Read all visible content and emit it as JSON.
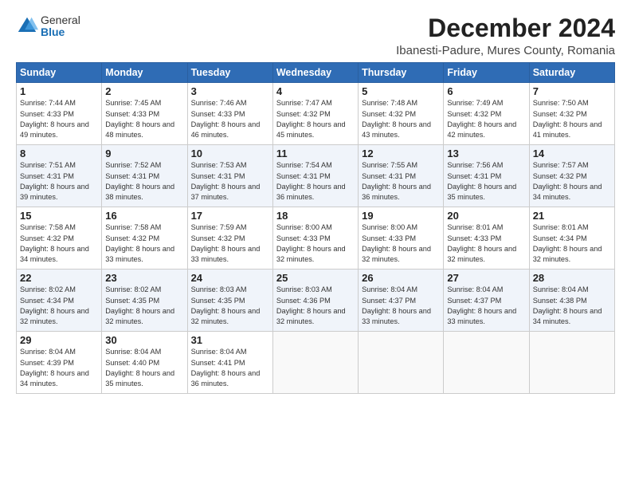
{
  "logo": {
    "general": "General",
    "blue": "Blue"
  },
  "title": "December 2024",
  "subtitle": "Ibanesti-Padure, Mures County, Romania",
  "weekdays": [
    "Sunday",
    "Monday",
    "Tuesday",
    "Wednesday",
    "Thursday",
    "Friday",
    "Saturday"
  ],
  "weeks": [
    [
      {
        "day": "1",
        "sunrise": "7:44 AM",
        "sunset": "4:33 PM",
        "daylight": "8 hours and 49 minutes."
      },
      {
        "day": "2",
        "sunrise": "7:45 AM",
        "sunset": "4:33 PM",
        "daylight": "8 hours and 48 minutes."
      },
      {
        "day": "3",
        "sunrise": "7:46 AM",
        "sunset": "4:33 PM",
        "daylight": "8 hours and 46 minutes."
      },
      {
        "day": "4",
        "sunrise": "7:47 AM",
        "sunset": "4:32 PM",
        "daylight": "8 hours and 45 minutes."
      },
      {
        "day": "5",
        "sunrise": "7:48 AM",
        "sunset": "4:32 PM",
        "daylight": "8 hours and 43 minutes."
      },
      {
        "day": "6",
        "sunrise": "7:49 AM",
        "sunset": "4:32 PM",
        "daylight": "8 hours and 42 minutes."
      },
      {
        "day": "7",
        "sunrise": "7:50 AM",
        "sunset": "4:32 PM",
        "daylight": "8 hours and 41 minutes."
      }
    ],
    [
      {
        "day": "8",
        "sunrise": "7:51 AM",
        "sunset": "4:31 PM",
        "daylight": "8 hours and 39 minutes."
      },
      {
        "day": "9",
        "sunrise": "7:52 AM",
        "sunset": "4:31 PM",
        "daylight": "8 hours and 38 minutes."
      },
      {
        "day": "10",
        "sunrise": "7:53 AM",
        "sunset": "4:31 PM",
        "daylight": "8 hours and 37 minutes."
      },
      {
        "day": "11",
        "sunrise": "7:54 AM",
        "sunset": "4:31 PM",
        "daylight": "8 hours and 36 minutes."
      },
      {
        "day": "12",
        "sunrise": "7:55 AM",
        "sunset": "4:31 PM",
        "daylight": "8 hours and 36 minutes."
      },
      {
        "day": "13",
        "sunrise": "7:56 AM",
        "sunset": "4:31 PM",
        "daylight": "8 hours and 35 minutes."
      },
      {
        "day": "14",
        "sunrise": "7:57 AM",
        "sunset": "4:32 PM",
        "daylight": "8 hours and 34 minutes."
      }
    ],
    [
      {
        "day": "15",
        "sunrise": "7:58 AM",
        "sunset": "4:32 PM",
        "daylight": "8 hours and 34 minutes."
      },
      {
        "day": "16",
        "sunrise": "7:58 AM",
        "sunset": "4:32 PM",
        "daylight": "8 hours and 33 minutes."
      },
      {
        "day": "17",
        "sunrise": "7:59 AM",
        "sunset": "4:32 PM",
        "daylight": "8 hours and 33 minutes."
      },
      {
        "day": "18",
        "sunrise": "8:00 AM",
        "sunset": "4:33 PM",
        "daylight": "8 hours and 32 minutes."
      },
      {
        "day": "19",
        "sunrise": "8:00 AM",
        "sunset": "4:33 PM",
        "daylight": "8 hours and 32 minutes."
      },
      {
        "day": "20",
        "sunrise": "8:01 AM",
        "sunset": "4:33 PM",
        "daylight": "8 hours and 32 minutes."
      },
      {
        "day": "21",
        "sunrise": "8:01 AM",
        "sunset": "4:34 PM",
        "daylight": "8 hours and 32 minutes."
      }
    ],
    [
      {
        "day": "22",
        "sunrise": "8:02 AM",
        "sunset": "4:34 PM",
        "daylight": "8 hours and 32 minutes."
      },
      {
        "day": "23",
        "sunrise": "8:02 AM",
        "sunset": "4:35 PM",
        "daylight": "8 hours and 32 minutes."
      },
      {
        "day": "24",
        "sunrise": "8:03 AM",
        "sunset": "4:35 PM",
        "daylight": "8 hours and 32 minutes."
      },
      {
        "day": "25",
        "sunrise": "8:03 AM",
        "sunset": "4:36 PM",
        "daylight": "8 hours and 32 minutes."
      },
      {
        "day": "26",
        "sunrise": "8:04 AM",
        "sunset": "4:37 PM",
        "daylight": "8 hours and 33 minutes."
      },
      {
        "day": "27",
        "sunrise": "8:04 AM",
        "sunset": "4:37 PM",
        "daylight": "8 hours and 33 minutes."
      },
      {
        "day": "28",
        "sunrise": "8:04 AM",
        "sunset": "4:38 PM",
        "daylight": "8 hours and 34 minutes."
      }
    ],
    [
      {
        "day": "29",
        "sunrise": "8:04 AM",
        "sunset": "4:39 PM",
        "daylight": "8 hours and 34 minutes."
      },
      {
        "day": "30",
        "sunrise": "8:04 AM",
        "sunset": "4:40 PM",
        "daylight": "8 hours and 35 minutes."
      },
      {
        "day": "31",
        "sunrise": "8:04 AM",
        "sunset": "4:41 PM",
        "daylight": "8 hours and 36 minutes."
      },
      null,
      null,
      null,
      null
    ]
  ]
}
